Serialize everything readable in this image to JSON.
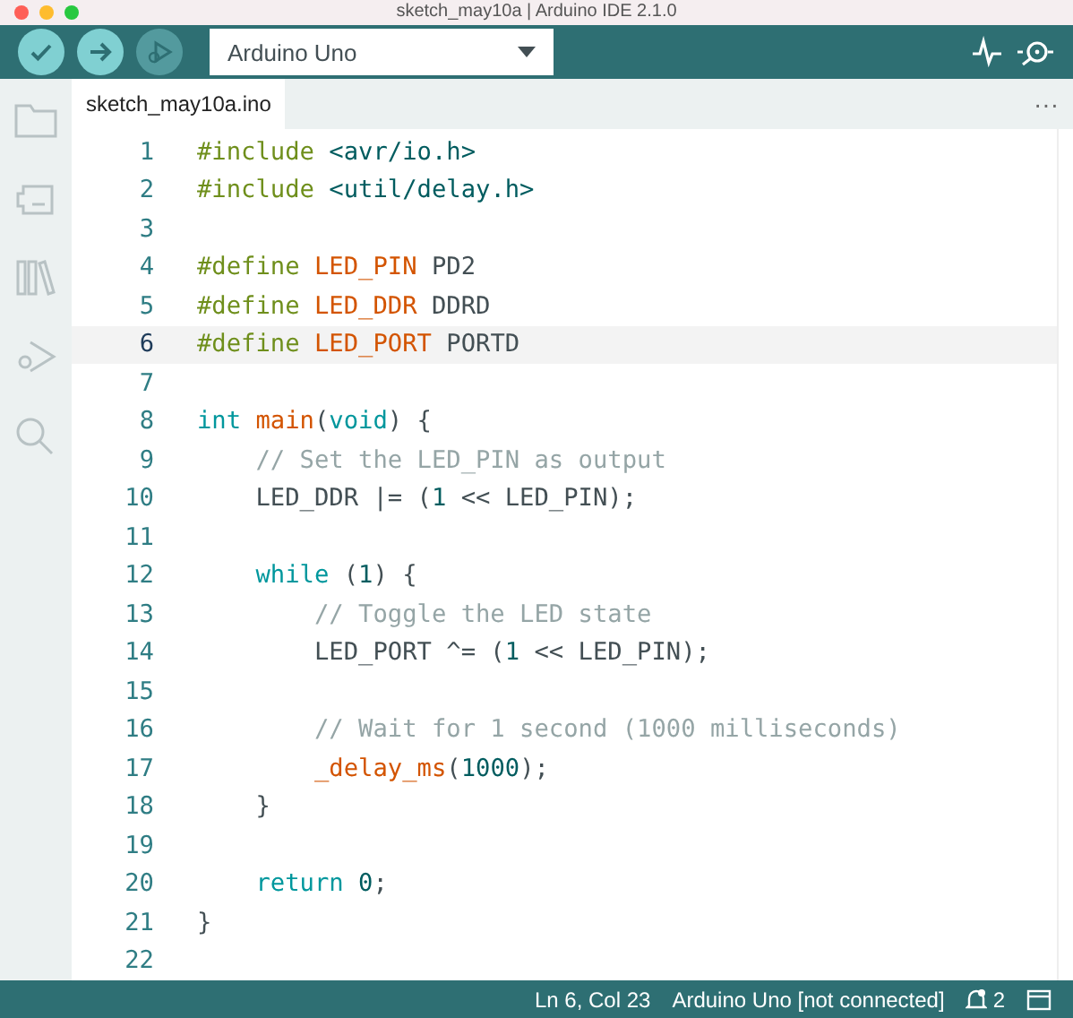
{
  "window": {
    "title": "sketch_may10a | Arduino IDE 2.1.0"
  },
  "toolbar": {
    "buttons": [
      {
        "kind": "verify",
        "disabled": false
      },
      {
        "kind": "upload",
        "disabled": false
      },
      {
        "kind": "debug",
        "disabled": true
      }
    ],
    "board": "Arduino Uno"
  },
  "sidebar": {
    "items": [
      {
        "kind": "folder",
        "selected": false
      },
      {
        "kind": "board",
        "selected": false
      },
      {
        "kind": "library",
        "selected": false
      },
      {
        "kind": "debug",
        "selected": false
      },
      {
        "kind": "search",
        "selected": false
      }
    ]
  },
  "tabs": [
    {
      "label": "sketch_may10a.ino",
      "selected": true
    }
  ],
  "more": "···",
  "editor": {
    "lines": [
      {
        "number": "1",
        "current": false,
        "tokens": [
          {
            "kind": "directive",
            "text": "#include"
          },
          {
            "kind": "header",
            "text": " <avr/io.h>"
          }
        ]
      },
      {
        "number": "2",
        "current": false,
        "tokens": [
          {
            "kind": "directive",
            "text": "#include"
          },
          {
            "kind": "header",
            "text": " <util/delay.h>"
          }
        ]
      },
      {
        "number": "3",
        "current": false
      },
      {
        "number": "4",
        "current": false,
        "tokens": [
          {
            "kind": "directive",
            "text": "#define"
          },
          {
            "kind": "macro",
            "text": " LED_PIN"
          },
          {
            "kind": "plain",
            "text": " PD2"
          }
        ]
      },
      {
        "number": "5",
        "current": false,
        "tokens": [
          {
            "kind": "directive",
            "text": "#define"
          },
          {
            "kind": "macro",
            "text": " LED_DDR"
          },
          {
            "kind": "plain",
            "text": " DDRD"
          }
        ]
      },
      {
        "number": "6",
        "current": true,
        "tokens": [
          {
            "kind": "directive",
            "text": "#define"
          },
          {
            "kind": "macro",
            "text": " LED_PORT"
          },
          {
            "kind": "plain",
            "text": " PORTD"
          }
        ]
      },
      {
        "number": "7",
        "current": false
      },
      {
        "number": "8",
        "current": false,
        "tokens": [
          {
            "kind": "keyword",
            "text": "int"
          },
          {
            "kind": "function",
            "text": " main"
          },
          {
            "kind": "plain",
            "text": "("
          },
          {
            "kind": "keyword",
            "text": "void"
          },
          {
            "kind": "plain",
            "text": ") {"
          }
        ]
      },
      {
        "number": "9",
        "current": false,
        "tokens": [
          {
            "kind": "comment",
            "text": "    // Set the LED_PIN as output"
          }
        ]
      },
      {
        "number": "10",
        "current": false,
        "tokens": [
          {
            "kind": "plain",
            "text": "    LED_DDR |= ("
          },
          {
            "kind": "number",
            "text": "1"
          },
          {
            "kind": "plain",
            "text": " << LED_PIN);"
          }
        ]
      },
      {
        "number": "11",
        "current": false
      },
      {
        "number": "12",
        "current": false,
        "tokens": [
          {
            "kind": "keyword",
            "text": "    while"
          },
          {
            "kind": "plain",
            "text": " ("
          },
          {
            "kind": "number",
            "text": "1"
          },
          {
            "kind": "plain",
            "text": ") {"
          }
        ]
      },
      {
        "number": "13",
        "current": false,
        "tokens": [
          {
            "kind": "comment",
            "text": "        // Toggle the LED state"
          }
        ]
      },
      {
        "number": "14",
        "current": false,
        "tokens": [
          {
            "kind": "plain",
            "text": "        LED_PORT ^= ("
          },
          {
            "kind": "number",
            "text": "1"
          },
          {
            "kind": "plain",
            "text": " << LED_PIN);"
          }
        ]
      },
      {
        "number": "15",
        "current": false
      },
      {
        "number": "16",
        "current": false,
        "tokens": [
          {
            "kind": "comment",
            "text": "        // Wait for 1 second (1000 milliseconds)"
          }
        ]
      },
      {
        "number": "17",
        "current": false,
        "tokens": [
          {
            "kind": "function",
            "text": "        _delay_ms"
          },
          {
            "kind": "plain",
            "text": "("
          },
          {
            "kind": "number",
            "text": "1000"
          },
          {
            "kind": "plain",
            "text": ");"
          }
        ]
      },
      {
        "number": "18",
        "current": false,
        "tokens": [
          {
            "kind": "plain",
            "text": "    }"
          }
        ]
      },
      {
        "number": "19",
        "current": false
      },
      {
        "number": "20",
        "current": false,
        "tokens": [
          {
            "kind": "keyword",
            "text": "    return"
          },
          {
            "kind": "number",
            "text": " 0"
          },
          {
            "kind": "plain",
            "text": ";"
          }
        ]
      },
      {
        "number": "21",
        "current": false,
        "tokens": [
          {
            "kind": "plain",
            "text": "}"
          }
        ]
      },
      {
        "number": "22",
        "current": false
      }
    ]
  },
  "status_bar": {
    "position": "Ln 6, Col 23",
    "board": "Arduino Uno [not connected]",
    "notifications": "2"
  }
}
